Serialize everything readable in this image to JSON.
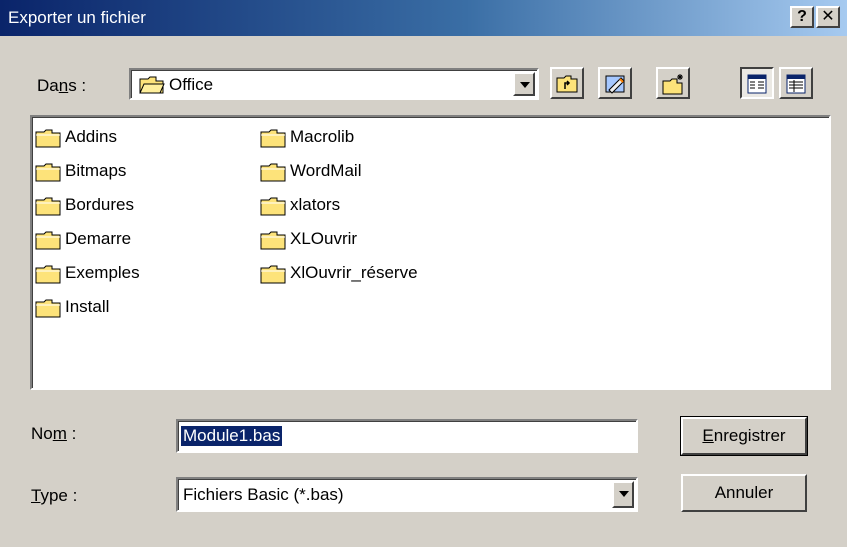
{
  "window": {
    "title": "Exporter un fichier",
    "help_label": "?",
    "close_label": "✕"
  },
  "lookin": {
    "label_prefix": "Da",
    "label_ul": "n",
    "label_suffix": "s :",
    "value": "Office"
  },
  "toolbar": {
    "icons": [
      "up-one-level-icon",
      "desktop-icon",
      "new-folder-icon",
      "list-view-icon",
      "details-view-icon"
    ]
  },
  "files": {
    "col1": [
      "Addins",
      "Bitmaps",
      "Bordures",
      "Demarre",
      "Exemples",
      "Install"
    ],
    "col2": [
      "Macrolib",
      "WordMail",
      "xlators",
      "XLOuvrir",
      "XlOuvrir_réserve"
    ]
  },
  "filename": {
    "label_prefix": "No",
    "label_ul": "m",
    "label_suffix": " :",
    "value": "Module1.bas"
  },
  "filetype": {
    "label_ul": "T",
    "label_suffix": "ype :",
    "value": "Fichiers Basic (*.bas)"
  },
  "buttons": {
    "save_ul": "E",
    "save_rest": "nregistrer",
    "cancel": "Annuler"
  }
}
